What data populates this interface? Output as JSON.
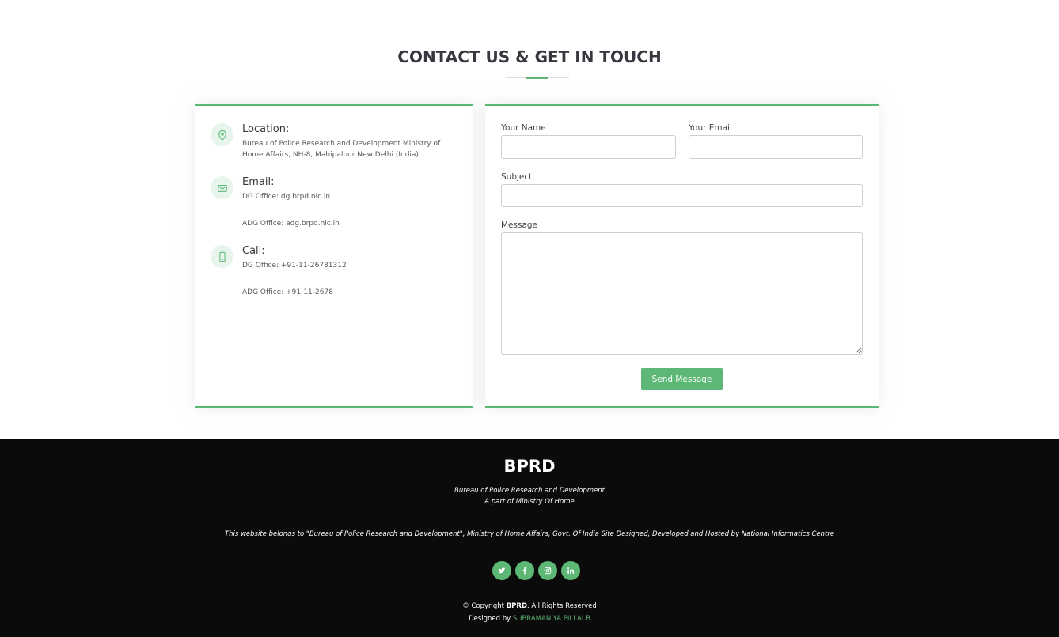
{
  "section": {
    "title": "CONTACT US & GET IN TOUCH"
  },
  "info": {
    "location": {
      "heading": "Location:",
      "line1": "Bureau of Police Research and Development Ministry of",
      "line2": "Home Affairs, NH-8, Mahipalpur New Delhi (India)",
      "icon": "map-pin-icon"
    },
    "email": {
      "heading": "Email:",
      "line1": "DG Office: dg.brpd.nic.in",
      "line2": "ADG Office: adg.brpd.nic.in",
      "icon": "envelope-icon"
    },
    "call": {
      "heading": "Call:",
      "line1": "DG Office: +91-11-26781312",
      "line2": "ADG Office: +91-11-2678",
      "icon": "phone-icon"
    }
  },
  "form": {
    "name_label": "Your Name",
    "name_value": "",
    "email_label": "Your Email",
    "email_value": "",
    "subject_label": "Subject",
    "subject_value": "",
    "message_label": "Message",
    "message_value": "",
    "submit_label": "Send Message"
  },
  "footer": {
    "logo": "BPRD",
    "tagline1": "Bureau of Police Research and Development",
    "tagline2": "A part of Ministry Of Home",
    "ownership": "This website belongs to \"Bureau of Police Research and Development\", Ministry of Home Affairs, Govt. Of India Site Designed, Developed and Hosted by National Informatics Centre",
    "social": [
      "twitter-icon",
      "facebook-icon",
      "instagram-icon",
      "linkedin-icon"
    ],
    "copyright_prefix": "© Copyright ",
    "copyright_brand": "BPRD",
    "copyright_suffix": ". All Rights Reserved",
    "designed_prefix": "Designed by ",
    "designer": "SUBRAMANIYA PILLAI.B"
  },
  "colors": {
    "accent": "#5cb874",
    "title": "#37373f",
    "footer_bg": "#0b0b0b"
  }
}
